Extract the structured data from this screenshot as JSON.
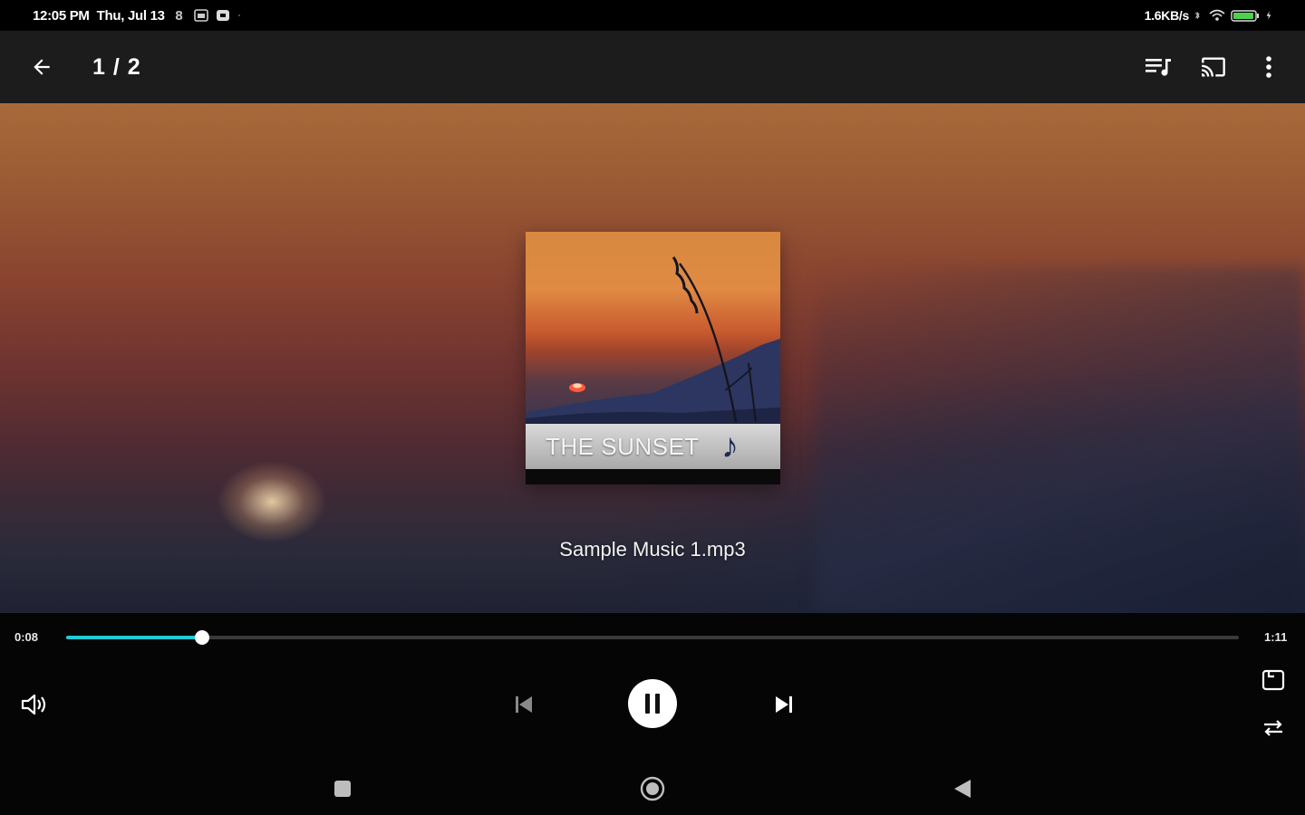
{
  "status_bar": {
    "time": "12:05 PM",
    "date": "Thu, Jul 13",
    "net_speed": "1.6KB/s",
    "icons": [
      "sim-icon",
      "gallery-icon",
      "notification-icon",
      "bluetooth-icon",
      "wifi-icon",
      "battery-icon",
      "charging-icon"
    ]
  },
  "toolbar": {
    "page_counter": "1 / 2",
    "icons": [
      "back-arrow-icon",
      "playlist-icon",
      "cast-icon",
      "more-vert-icon"
    ]
  },
  "album": {
    "title": "THE SUNSET",
    "note_glyph": "♪"
  },
  "track": {
    "title": "Sample Music 1.mp3"
  },
  "playback": {
    "elapsed": "0:08",
    "duration": "1:11",
    "progress_fraction": 0.116,
    "state": "playing"
  },
  "controls": {
    "icons": [
      "volume-icon",
      "previous-icon",
      "pause-icon",
      "next-icon",
      "screen-rotate-icon",
      "repeat-shuffle-icon"
    ]
  },
  "nav_bar": {
    "icons": [
      "recents-icon",
      "home-icon",
      "back-triangle-icon"
    ]
  },
  "colors": {
    "accent": "#20c9d6",
    "toolbar_bg": "#1c1c1c",
    "controls_bg": "#050505"
  }
}
